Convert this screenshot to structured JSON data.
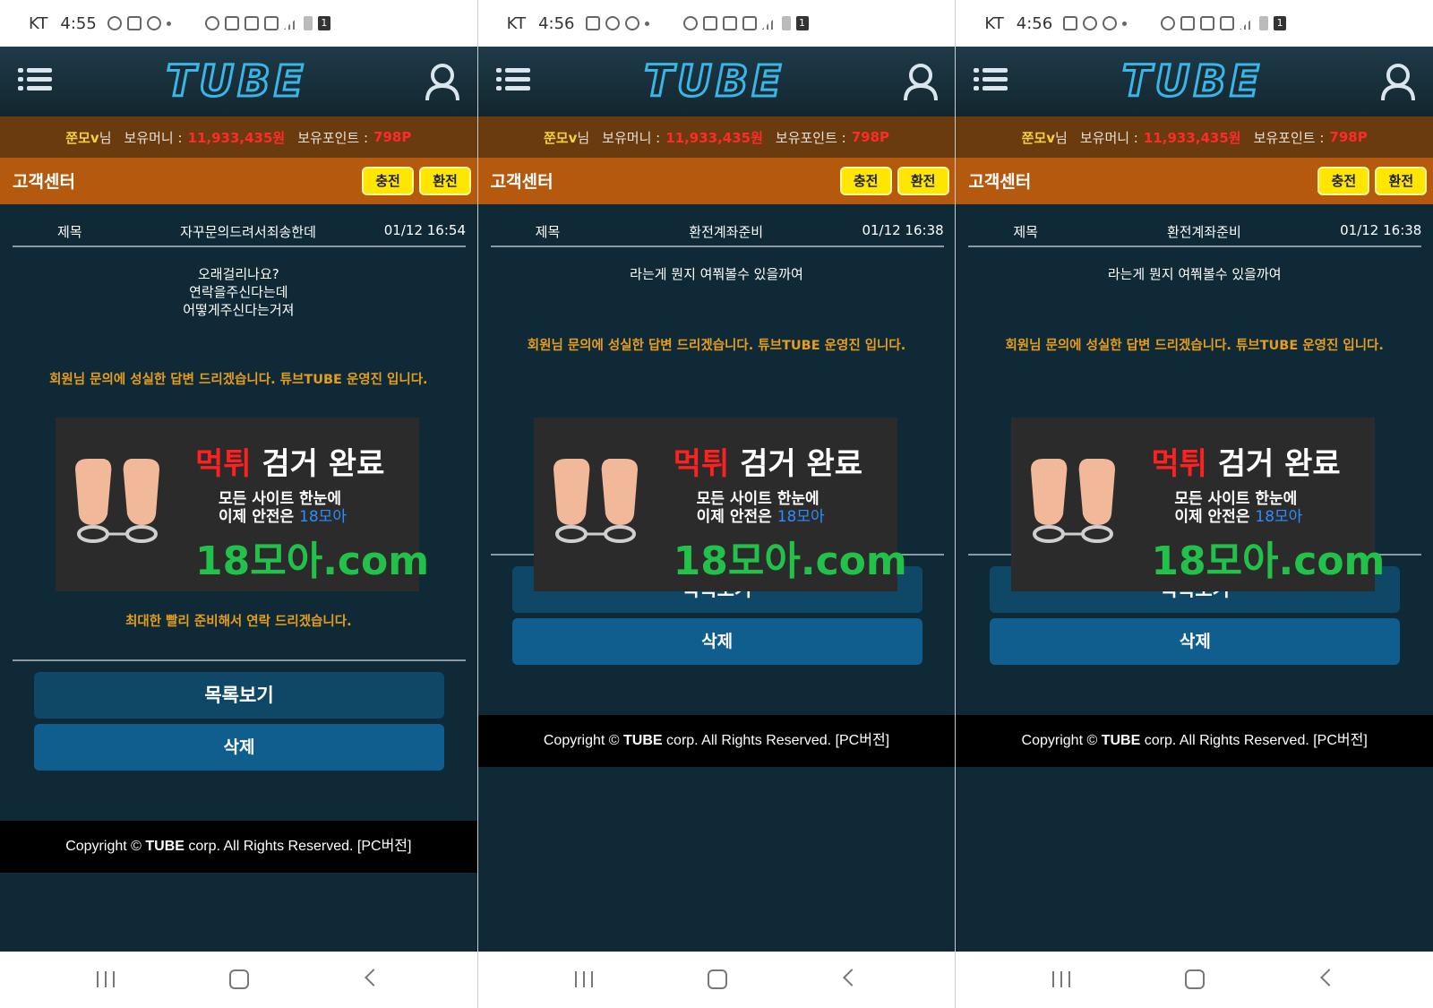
{
  "screens": [
    {
      "status": {
        "carrier": "KT",
        "time": "4:55"
      },
      "header": {
        "logo": "TUBE"
      },
      "infobar": {
        "username": "쭌모v",
        "honorific": "님",
        "money_label": "보유머니 :",
        "money": "11,933,435원",
        "points_label": "보유포인트 :",
        "points": "798P"
      },
      "section": {
        "title": "고객센터",
        "charge_label": "충전",
        "exchange_label": "환전"
      },
      "post": {
        "subject_label": "제목",
        "subject": "자꾸문의드려서죄송한데",
        "date": "01/12 16:54",
        "body_lines": [
          "오래걸리나요?",
          "연락을주신다는데",
          "어떻게주신다는거져"
        ],
        "answer": "회원님 문의에 성실한 답변 드리겠습니다.  튜브TUBE 운영진 입니다.",
        "answer2": "최대한 빨리 준비해서 연락 드리겠습니다."
      },
      "ad": {
        "title_red": "먹튀",
        "title_rest": " 검거 완료",
        "line1": "모든 사이트 한눈에",
        "line2_prefix": "이제 안전은 ",
        "line2_brand": "18모아",
        "url": "18모아.com"
      },
      "buttons": {
        "list_label": "목록보기",
        "delete_label": "삭제"
      },
      "footer": {
        "prefix": "Copyright © ",
        "brand": "TUBE",
        "suffix": " corp. All Rights Reserved. [PC버전]"
      }
    },
    {
      "status": {
        "carrier": "KT",
        "time": "4:56"
      },
      "header": {
        "logo": "TUBE"
      },
      "infobar": {
        "username": "쭌모v",
        "honorific": "님",
        "money_label": "보유머니 :",
        "money": "11,933,435원",
        "points_label": "보유포인트 :",
        "points": "798P"
      },
      "section": {
        "title": "고객센터",
        "charge_label": "충전",
        "exchange_label": "환전"
      },
      "post": {
        "subject_label": "제목",
        "subject": "환전계좌준비",
        "date": "01/12 16:38",
        "body_lines": [
          "라는게 뭔지 여쭤볼수 있을까여"
        ],
        "answer": "회원님 문의에 성실한 답변 드리겠습니다.  튜브TUBE 운영진 입니다."
      },
      "ad": {
        "title_red": "먹튀",
        "title_rest": " 검거 완료",
        "line1": "모든 사이트 한눈에",
        "line2_prefix": "이제 안전은 ",
        "line2_brand": "18모아",
        "url": "18모아.com"
      },
      "buttons": {
        "list_label": "목록보기",
        "delete_label": "삭제"
      },
      "footer": {
        "prefix": "Copyright © ",
        "brand": "TUBE",
        "suffix": " corp. All Rights Reserved. [PC버전]"
      }
    },
    {
      "status": {
        "carrier": "KT",
        "time": "4:56"
      },
      "header": {
        "logo": "TUBE"
      },
      "infobar": {
        "username": "쭌모v",
        "honorific": "님",
        "money_label": "보유머니 :",
        "money": "11,933,435원",
        "points_label": "보유포인트 :",
        "points": "798P"
      },
      "section": {
        "title": "고객센터",
        "charge_label": "충전",
        "exchange_label": "환전"
      },
      "post": {
        "subject_label": "제목",
        "subject": "환전계좌준비",
        "date": "01/12 16:38",
        "body_lines": [
          "라는게 뭔지 여쭤볼수 있을까여"
        ],
        "answer": "회원님 문의에 성실한 답변 드리겠습니다.  튜브TUBE 운영진 입니다."
      },
      "ad": {
        "title_red": "먹튀",
        "title_rest": " 검거 완료",
        "line1": "모든 사이트 한눈에",
        "line2_prefix": "이제 안전은 ",
        "line2_brand": "18모아",
        "url": "18모아.com"
      },
      "buttons": {
        "list_label": "목록보기",
        "delete_label": "삭제"
      },
      "footer": {
        "prefix": "Copyright © ",
        "brand": "TUBE",
        "suffix": " corp. All Rights Reserved. [PC버전]"
      }
    }
  ],
  "colors": {
    "header_bg": "#1a3340",
    "infobar_bg": "#6b3b10",
    "section_bg": "#b5590e",
    "content_bg": "#0f2a36",
    "button_yellow": "#ffe600",
    "answer_orange": "#e69d1e",
    "money_red": "#ff2a2a",
    "delete_blue": "#0f5e8e"
  },
  "icons": [
    "menu-icon",
    "user-icon",
    "recent-apps-icon",
    "home-icon",
    "back-icon"
  ]
}
